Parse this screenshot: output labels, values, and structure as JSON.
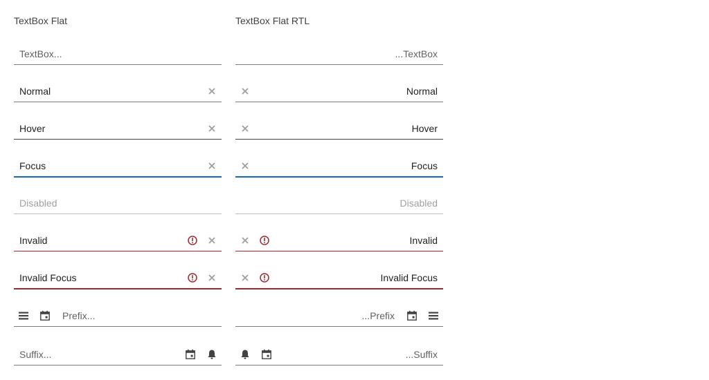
{
  "ltr": {
    "title": "TextBox Flat",
    "placeholder": "TextBox...",
    "normal": "Normal",
    "hover": "Hover",
    "focus": "Focus",
    "disabled": "Disabled",
    "invalid": "Invalid",
    "invalid_focus": "Invalid Focus",
    "prefix_placeholder": "Prefix...",
    "suffix_placeholder": "Suffix..."
  },
  "rtl": {
    "title": "TextBox Flat RTL",
    "placeholder": "...TextBox",
    "normal": "Normal",
    "hover": "Hover",
    "focus": "Focus",
    "disabled": "Disabled",
    "invalid": "Invalid",
    "invalid_focus": "Invalid Focus",
    "prefix_placeholder": "...Prefix",
    "suffix_placeholder": "...Suffix"
  },
  "icons": {
    "clear": "close-icon",
    "error": "exclamation-circle-icon",
    "menu": "menu-icon",
    "calendar": "calendar-icon",
    "bell": "bell-icon"
  },
  "colors": {
    "focus_accent": "#0f6cbd",
    "error_accent": "#a4262c",
    "icon_gray": "#9e9e9e"
  }
}
